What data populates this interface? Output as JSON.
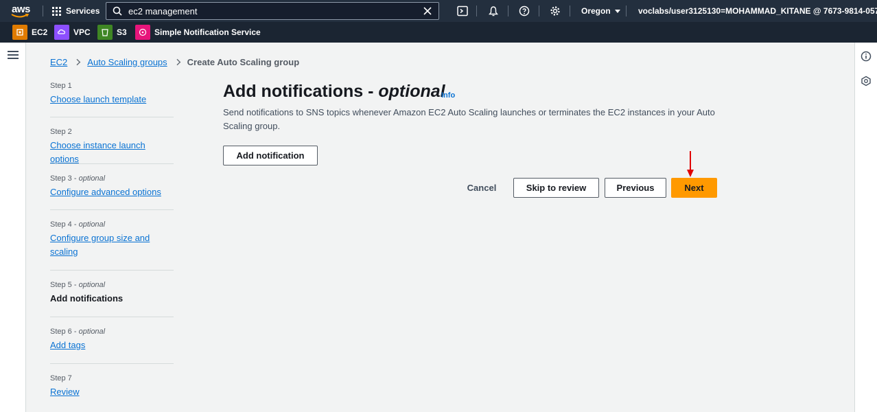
{
  "topnav": {
    "logo": "aws",
    "services_label": "Services",
    "search_value": "ec2 management",
    "region_label": "Oregon",
    "account_label": "voclabs/user3125130=MOHAMMAD_KITANE @ 7673-9814-0578"
  },
  "favorites": [
    {
      "label": "EC2",
      "color": "#e07b00",
      "icon": "ec2-icon"
    },
    {
      "label": "VPC",
      "color": "#8c4fff",
      "icon": "vpc-icon"
    },
    {
      "label": "S3",
      "color": "#3f8624",
      "icon": "s3-icon"
    },
    {
      "label": "Simple Notification Service",
      "color": "#e7157b",
      "icon": "sns-icon"
    }
  ],
  "breadcrumb": {
    "items": [
      "EC2",
      "Auto Scaling groups"
    ],
    "current": "Create Auto Scaling group"
  },
  "steps": [
    {
      "label": "Step 1",
      "optional": "",
      "title": "Choose launch template"
    },
    {
      "label": "Step 2",
      "optional": "",
      "title": "Choose instance launch options"
    },
    {
      "label": "Step 3 - ",
      "optional": "optional",
      "title": "Configure advanced options"
    },
    {
      "label": "Step 4 - ",
      "optional": "optional",
      "title": "Configure group size and scaling"
    },
    {
      "label": "Step 5 - ",
      "optional": "optional",
      "title": "Add notifications"
    },
    {
      "label": "Step 6 - ",
      "optional": "optional",
      "title": "Add tags"
    },
    {
      "label": "Step 7",
      "optional": "",
      "title": "Review"
    }
  ],
  "main": {
    "title_plain": "Add notifications - ",
    "title_italic": "optional",
    "info_label": "Info",
    "description": "Send notifications to SNS topics whenever Amazon EC2 Auto Scaling launches or terminates the EC2 instances in your Auto Scaling group.",
    "add_notification_label": "Add notification"
  },
  "actions": {
    "cancel_label": "Cancel",
    "skip_label": "Skip to review",
    "previous_label": "Previous",
    "next_label": "Next"
  },
  "colors": {
    "nav_bg": "#232f3e",
    "primary": "#ff9900",
    "link": "#0972d3",
    "annotation": "#e00000"
  }
}
